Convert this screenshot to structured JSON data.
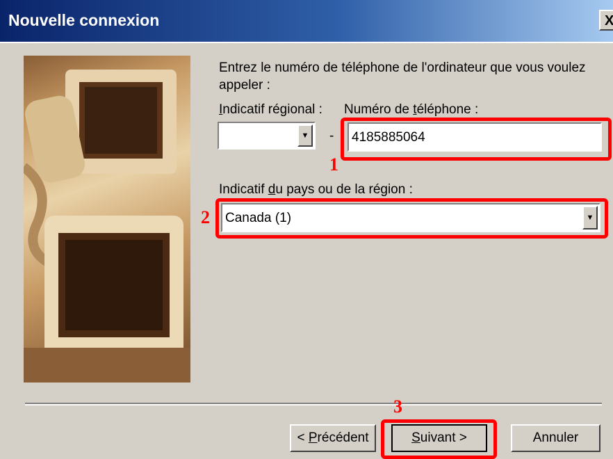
{
  "window": {
    "title": "Nouvelle connexion",
    "close_glyph": "X"
  },
  "instructions": "Entrez le numéro de téléphone de l'ordinateur que vous voulez appeler :",
  "area_code": {
    "label_prefix": "I",
    "label_rest": "ndicatif régional :",
    "value": ""
  },
  "phone": {
    "label_before": "Numéro de ",
    "label_accel": "t",
    "label_after": "éléphone :",
    "dash": "-",
    "value": "4185885064"
  },
  "country": {
    "label_before": "Indicatif ",
    "label_accel": "d",
    "label_after": "u pays ou de la région :",
    "value": "Canada (1)"
  },
  "buttons": {
    "back": {
      "prefix": "< ",
      "accel": "P",
      "rest": "récédent"
    },
    "next": {
      "accel": "S",
      "rest": "uivant >"
    },
    "cancel": "Annuler"
  },
  "annotations": {
    "marker_1": "1",
    "marker_2": "2",
    "marker_3": "3",
    "color": "#ff0000"
  },
  "icons": {
    "dropdown_arrow": "▼"
  }
}
